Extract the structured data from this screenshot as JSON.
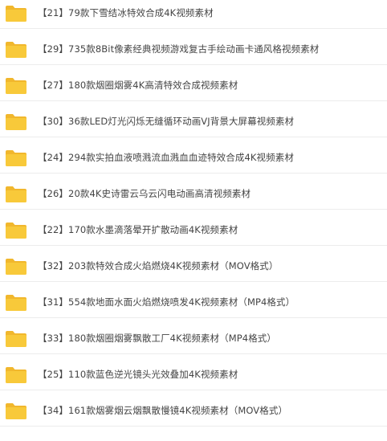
{
  "file_list": {
    "icon": "folder-icon",
    "folder_color": "#f8c93a",
    "folder_tab_color": "#f1b72d",
    "items": [
      {
        "name": "【21】79款下雪结冰特效合成4K视频素材"
      },
      {
        "name": "【29】735款8Bit像素经典视频游戏复古手绘动画卡通风格视频素材"
      },
      {
        "name": "【27】180款烟圈烟雾4K高清特效合成视频素材"
      },
      {
        "name": "【30】36款LED灯光闪烁无缝循环动画VJ背景大屏幕视频素材"
      },
      {
        "name": "【24】294款实拍血液喷溅流血溅血血迹特效合成4K视频素材"
      },
      {
        "name": "【26】20款4K史诗雷云乌云闪电动画高清视频素材"
      },
      {
        "name": "【22】170款水墨滴落晕开扩散动画4K视频素材"
      },
      {
        "name": "【32】203款特效合成火焰燃烧4K视频素材（MOV格式）"
      },
      {
        "name": "【31】554款地面水面火焰燃烧喷发4K视频素材（MP4格式）"
      },
      {
        "name": "【33】180款烟圈烟雾飘散工厂4K视频素材（MP4格式）"
      },
      {
        "name": "【25】110款蓝色逆光镜头光效叠加4K视频素材"
      },
      {
        "name": "【34】161款烟雾烟云烟飘散慢镜4K视频素材（MOV格式）"
      }
    ]
  }
}
